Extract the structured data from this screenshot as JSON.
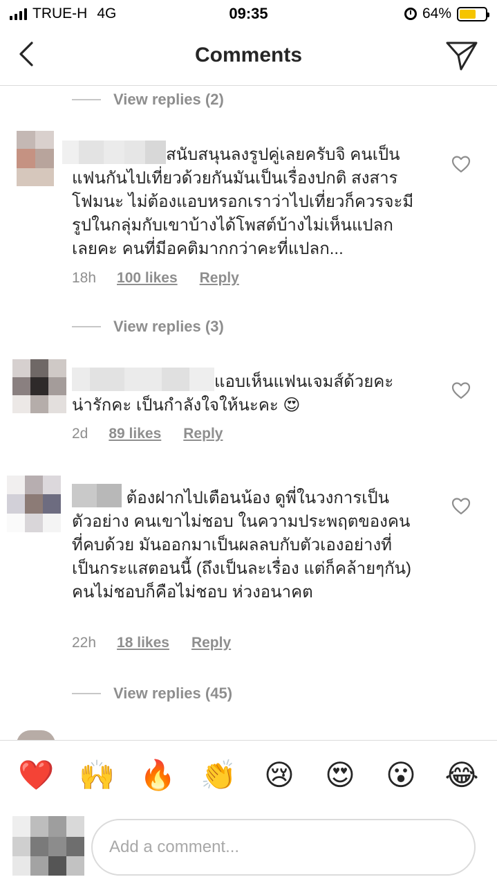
{
  "status_bar": {
    "carrier": "TRUE-H",
    "network": "4G",
    "time": "09:35",
    "battery": "64%",
    "battery_level": 0.64,
    "battery_color": "#f5c400"
  },
  "header": {
    "title": "Comments",
    "back_icon": "chevron-left-icon",
    "send_icon": "paper-plane-icon"
  },
  "comments": [
    {
      "view_replies_above": "View replies (2)",
      "text": "สนับสนุนลงรูปคู่เลยครับจิ คนเป็นแฟนกันไปเที่ยวด้วยกันมันเป็นเรื่องปกติ สงสารโฟมนะ ไม่ต้องแอบหรอกเราว่าไปเที่ยวก็ควรจะมีรูปในกลุ่มกับเขาบ้างได้โพสต์บ้างไม่เห็นแปลกเลยคะ คนที่มีอคติมากกว่าคะที่แปลก...",
      "time": "18h",
      "likes": "100 likes",
      "reply": "Reply"
    },
    {
      "view_replies_above": "View replies (3)",
      "text": "แอบเห็นแฟนเจมส์ด้วยคะ น่ารักคะ เป็นกำลังใจให้นะคะ 😍",
      "time": "2d",
      "likes": "89 likes",
      "reply": "Reply"
    },
    {
      "text": "ต้องฝากไปเตือนน้อง ดูพี่ในวงการเป็นตัวอย่าง คนเขาไม่ชอบ ในความประพฤตของคนที่คบด้วย มันออกมาเป็นผลลบกับตัวเองอย่างที่เป็นกระแสตอนนี้ (ถึงเป็นละเรื่อง แต่ก็คล้ายๆกัน) คนไม่ชอบก็คือไม่ชอบ ห่วงอนาคต",
      "time": "22h",
      "likes": "18 likes",
      "reply": "Reply"
    }
  ],
  "view_replies_bottom": "View replies (45)",
  "emoji_bar": [
    {
      "name": "red-heart-emoji",
      "glyph": "❤️"
    },
    {
      "name": "raising-hands-emoji",
      "glyph": "🙌"
    },
    {
      "name": "fire-emoji",
      "glyph": "🔥"
    },
    {
      "name": "clapping-hands-emoji",
      "glyph": "👏"
    },
    {
      "name": "crying-face-emoji",
      "glyph": "😢"
    },
    {
      "name": "heart-eyes-emoji",
      "glyph": "😍"
    },
    {
      "name": "surprised-face-emoji",
      "glyph": "😮"
    },
    {
      "name": "tears-of-joy-emoji",
      "glyph": "😂"
    }
  ],
  "composer": {
    "placeholder": "Add a comment..."
  }
}
